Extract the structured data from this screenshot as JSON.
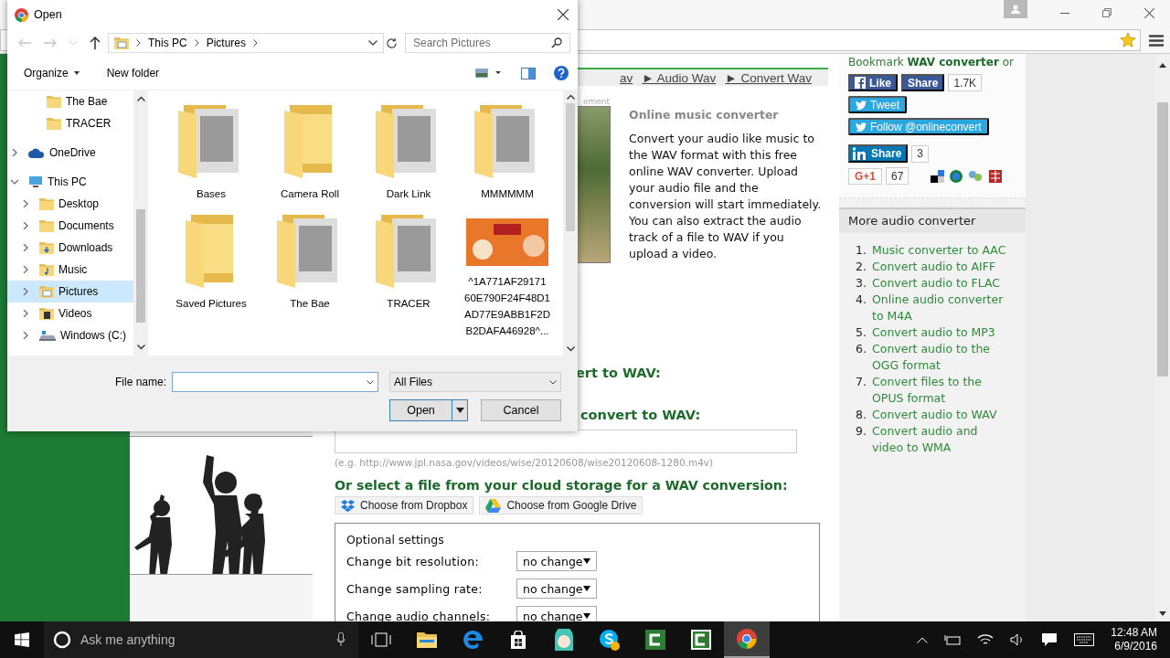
{
  "browser": {
    "breadcrumb": [
      "av",
      "► Audio Wav",
      "► Convert Wav"
    ],
    "ad_label": "ement",
    "intro": {
      "title": "Online music converter",
      "text": "Convert your audio like music to the WAV format with this free online WAV converter. Upload your audio file and the conversion will start immediately. You can also extract the audio track of a file to WAV if you upload a video."
    },
    "upload_heading": "ert to WAV:",
    "url_heading": "convert to WAV:",
    "url_hint": "(e.g. http://www.jpl.nasa.gov/videos/wise/20120608/wise20120608-1280.m4v)",
    "cloud_heading": "Or select a file from your cloud storage for a WAV conversion:",
    "cloud_buttons": [
      {
        "kind": "dropbox",
        "label": "Choose from Dropbox"
      },
      {
        "kind": "google-drive",
        "label": "Choose from Google Drive"
      }
    ],
    "optional_settings": {
      "title": "Optional settings",
      "rows": [
        {
          "label": "Change bit resolution:",
          "value": "no change"
        },
        {
          "label": "Change sampling rate:",
          "value": "no change"
        },
        {
          "label": "Change audio channels:",
          "value": "no change"
        }
      ]
    },
    "sidebar": {
      "bookmark": "Bookmark **WAV converter** or",
      "facebook_like": "Like",
      "facebook_share": "Share",
      "facebook_count": "1.7K",
      "tweet": "Tweet",
      "follow": "Follow @onlineconvert",
      "linkedin_share": "Share",
      "linkedin_count": "3",
      "gplus": "G+1",
      "gplus_count": "67",
      "more_title": "More audio converter",
      "more_links": [
        {
          "number": "1.",
          "label": "Music converter to AAC"
        },
        {
          "number": "2.",
          "label": "Convert audio to AIFF"
        },
        {
          "number": "3.",
          "label": "Convert audio to FLAC"
        },
        {
          "number": "4.",
          "label": "Online audio converter to M4A"
        },
        {
          "number": "5.",
          "label": "Convert audio to MP3"
        },
        {
          "number": "6.",
          "label": "Convert audio to the OGG format"
        },
        {
          "number": "7.",
          "label": "Convert files to the OPUS format"
        },
        {
          "number": "8.",
          "label": "Convert audio to WAV"
        },
        {
          "number": "9.",
          "label": "Convert audio and video to WMA"
        }
      ]
    }
  },
  "dialog": {
    "title": "Open",
    "path": [
      "This PC",
      "Pictures"
    ],
    "search_placeholder": "Search Pictures",
    "organize": "Organize",
    "new_folder": "New folder",
    "tree_tail": [
      {
        "label": "The Bae",
        "kind": "folder",
        "selected": false
      },
      {
        "label": "TRACER",
        "kind": "folder",
        "selected": false
      }
    ],
    "tree": [
      {
        "label": "OneDrive",
        "kind": "cloud",
        "expanded": false,
        "selected": false
      },
      {
        "label": "This PC",
        "kind": "pc",
        "expanded": true,
        "selected": false,
        "children": [
          {
            "label": "Desktop",
            "kind": "desktop",
            "expanded": false,
            "selected": false
          },
          {
            "label": "Documents",
            "kind": "documents",
            "expanded": false,
            "selected": false
          },
          {
            "label": "Downloads",
            "kind": "downloads",
            "expanded": false,
            "selected": false
          },
          {
            "label": "Music",
            "kind": "music",
            "expanded": false,
            "selected": false
          },
          {
            "label": "Pictures",
            "kind": "pictures",
            "expanded": false,
            "selected": true
          },
          {
            "label": "Videos",
            "kind": "videos",
            "expanded": false,
            "selected": false
          },
          {
            "label": "Windows (C:)",
            "kind": "drive",
            "expanded": false,
            "selected": false
          }
        ]
      }
    ],
    "files": [
      {
        "name": "Bases",
        "kind": "folder-preview"
      },
      {
        "name": "Camera Roll",
        "kind": "folder"
      },
      {
        "name": "Dark Link",
        "kind": "folder-preview"
      },
      {
        "name": "MMMMMM",
        "kind": "folder-preview"
      },
      {
        "name": "Saved Pictures",
        "kind": "folder"
      },
      {
        "name": "The Bae",
        "kind": "folder-preview"
      },
      {
        "name": "TRACER",
        "kind": "folder-preview"
      },
      {
        "name": "^1A771AF29171 60E790F24F48D1 AD77E9ABB1F2D B2DAFA46928^...",
        "kind": "image"
      }
    ],
    "file_name_label": "File name:",
    "file_type": "All Files",
    "open": "Open",
    "cancel": "Cancel"
  },
  "taskbar": {
    "search_placeholder": "Ask me anything",
    "time": "12:48 AM",
    "date": "6/9/2016",
    "apps": [
      {
        "kind": "file-explorer",
        "active": false
      },
      {
        "kind": "edge",
        "active": false
      },
      {
        "kind": "store",
        "active": false
      },
      {
        "kind": "character",
        "active": false
      },
      {
        "kind": "skype",
        "active": false
      },
      {
        "kind": "camtasia",
        "active": false
      },
      {
        "kind": "camtasia-recorder",
        "active": false
      },
      {
        "kind": "chrome",
        "active": true
      }
    ]
  }
}
